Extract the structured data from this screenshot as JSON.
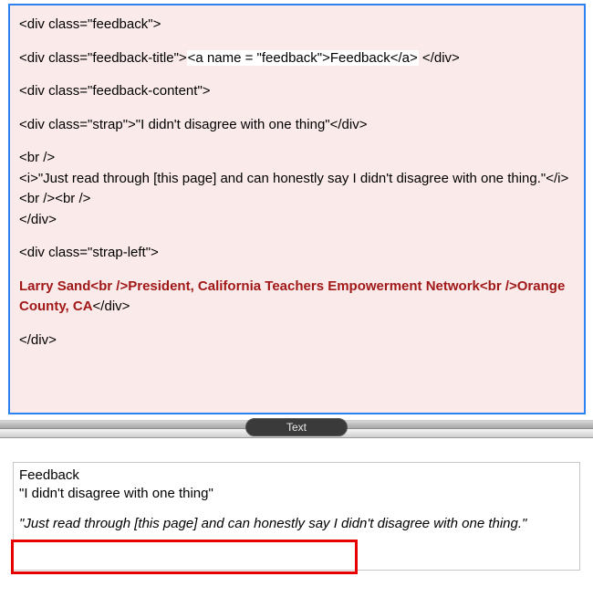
{
  "editor": {
    "l1_open": "<div class=\"feedback\">",
    "l2_a": "<div class=\"feedback-title\">",
    "l2_b": "<a name = \"feedback\">",
    "l2_c": "Feedback",
    "l2_d": "</a>",
    "l2_e": " </div>",
    "l3": "<div class=\"feedback-content\">",
    "l4": "<div class=\"strap\">\"I didn't disagree with one thing\"</div>",
    "l5": "<br />",
    "l6": "<i>\"Just read through [this page] and can honestly say I didn't disagree with one thing.\"</i>",
    "l7": "<br /><br />",
    "l8": "</div>",
    "l9": "<div class=\"strap-left\">",
    "author_a": "Larry Sand",
    "author_br1": "<br />",
    "author_b": "President, California Teachers Empowerment Network",
    "author_br2": "<br />",
    "author_c": "Orange County, CA",
    "author_close": "</div>",
    "l10": "</div>"
  },
  "divider": {
    "label": "Text"
  },
  "preview": {
    "title": "Feedback",
    "strap": "\"I didn't disagree with one thing\"",
    "body": "\"Just read through [this page] and can honestly say I didn't disagree with one thing.\""
  }
}
